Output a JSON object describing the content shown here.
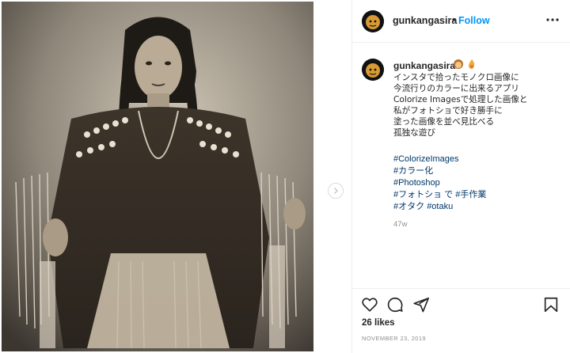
{
  "post": {
    "image_icon": "sepia-portrait-photo"
  },
  "header": {
    "username": "gunkangasira",
    "separator": "•",
    "follow_label": "Follow",
    "more_icon": "more-options-icon"
  },
  "caption": {
    "username": "gunkangasira",
    "emoji": [
      "woman-emoji",
      "fire-emoji"
    ],
    "lines": [
      "インスタで拾ったモノクロ画像に",
      "今流行りのカラーに出来るアプリ",
      "Colorize Imagesで処理した画像と",
      "私がフォトショで好き勝手に",
      "塗った画像を並べ見比べる",
      "孤独な遊び"
    ],
    "hashtags": [
      [
        "#ColorizeImages"
      ],
      [
        "#カラー化"
      ],
      [
        "#Photoshop"
      ],
      [
        "#フォトショ で",
        "#手作業"
      ],
      [
        "#オタク",
        "#otaku"
      ]
    ],
    "time": "47w"
  },
  "actions": {
    "icons": [
      "heart-icon",
      "comment-icon",
      "share-icon",
      "bookmark-icon"
    ],
    "likes": "26 likes",
    "date": "NOVEMBER 23, 2019"
  },
  "colors": {
    "follow": "#0095f6",
    "hashtag": "#00376b",
    "muted": "#8e8e8e",
    "photo_sepia": "#c9bca6"
  }
}
